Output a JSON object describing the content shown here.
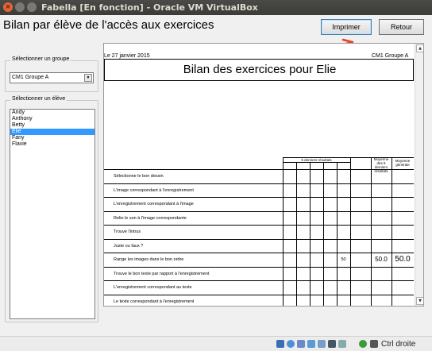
{
  "window": {
    "title": "Fabella [En fonction] - Oracle VM VirtualBox"
  },
  "app": {
    "page_title": "Bilan par élève de l'accès aux exercices",
    "print_label": "Imprimer",
    "back_label": "Retour"
  },
  "group_box": {
    "label": "Sélectionner un groupe",
    "selected": "CM1 Groupe A"
  },
  "student_box": {
    "label": "Sélectionner un élève",
    "students": [
      "Andy",
      "Anthony",
      "Betty",
      "Elie",
      "Fany",
      "Flavie"
    ],
    "selected": "Elie"
  },
  "report": {
    "date": "Le 27 janvier 2015",
    "class": "CM1 Groupe A",
    "title": "Bilan des exercices pour Elie",
    "col_last_results": "5 derniers résultats",
    "col_avg_last": "Moyenne des 5 derniers résultats",
    "col_avg_general": "Moyenne générale",
    "rows": [
      {
        "label": "Sélectionne le bon dessin",
        "results": [
          "",
          "",
          "",
          "",
          ""
        ],
        "avg_last": "",
        "avg_general": ""
      },
      {
        "label": "L'image correspondant à l'enregistrement",
        "results": [
          "",
          "",
          "",
          "",
          ""
        ],
        "avg_last": "",
        "avg_general": ""
      },
      {
        "label": "L'enregistrement correspondant à l'image",
        "results": [
          "",
          "",
          "",
          "",
          ""
        ],
        "avg_last": "",
        "avg_general": ""
      },
      {
        "label": "Relie le son à l'image correspondante",
        "results": [
          "",
          "",
          "",
          "",
          ""
        ],
        "avg_last": "",
        "avg_general": ""
      },
      {
        "label": "Trouve l'intrus",
        "results": [
          "",
          "",
          "",
          "",
          ""
        ],
        "avg_last": "",
        "avg_general": ""
      },
      {
        "label": "Juste ou faux ?",
        "results": [
          "",
          "",
          "",
          "",
          ""
        ],
        "avg_last": "",
        "avg_general": ""
      },
      {
        "label": "Range les images dans le bon ordre",
        "results": [
          "",
          "",
          "",
          "",
          "50"
        ],
        "avg_last": "50.0",
        "avg_general": "50.0"
      },
      {
        "label": "Trouve le bon texte par rapport à l'enregistrement",
        "results": [
          "",
          "",
          "",
          "",
          ""
        ],
        "avg_last": "",
        "avg_general": ""
      },
      {
        "label": "L'enregistrement correspondant au texte",
        "results": [
          "",
          "",
          "",
          "",
          ""
        ],
        "avg_last": "",
        "avg_general": ""
      },
      {
        "label": "Le texte correspondant à l'enregistrement",
        "results": [
          "",
          "",
          "",
          "",
          ""
        ],
        "avg_last": "",
        "avg_general": ""
      }
    ]
  },
  "statusbar": {
    "host_key": "Ctrl droite"
  },
  "colors": {
    "accent_arrow": "#e8402a",
    "selection": "#3399ff"
  }
}
